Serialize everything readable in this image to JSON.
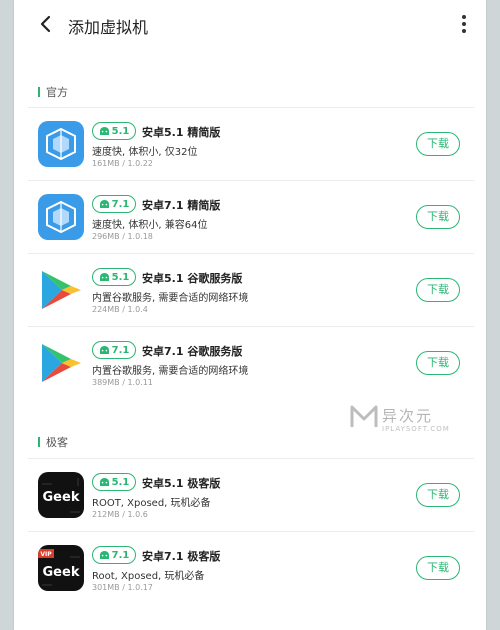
{
  "header": {
    "title": "添加虚拟机"
  },
  "sections": [
    {
      "label": "官方",
      "items": [
        {
          "version": "5.1",
          "name": "安卓5.1 精简版",
          "desc": "速度快, 体积小, 仅32位",
          "meta": "161MB / 1.0.22",
          "button": "下载",
          "icon": "vmos-cube-icon"
        },
        {
          "version": "7.1",
          "name": "安卓7.1 精简版",
          "desc": "速度快, 体积小, 兼容64位",
          "meta": "296MB / 1.0.18",
          "button": "下载",
          "icon": "vmos-cube-icon"
        },
        {
          "version": "5.1",
          "name": "安卓5.1 谷歌服务版",
          "desc": "内置谷歌服务, 需要合适的网络环境",
          "meta": "224MB / 1.0.4",
          "button": "下载",
          "icon": "google-play-icon"
        },
        {
          "version": "7.1",
          "name": "安卓7.1 谷歌服务版",
          "desc": "内置谷歌服务, 需要合适的网络环境",
          "meta": "389MB / 1.0.11",
          "button": "下载",
          "icon": "google-play-icon"
        }
      ]
    },
    {
      "label": "极客",
      "items": [
        {
          "version": "5.1",
          "name": "安卓5.1 极客版",
          "desc": "ROOT, Xposed, 玩机必备",
          "meta": "212MB / 1.0.6",
          "button": "下载",
          "icon": "geek-icon",
          "icon_text": "Geek"
        },
        {
          "version": "7.1",
          "name": "安卓7.1 极客版",
          "desc": "Root, Xposed, 玩机必备",
          "meta": "301MB / 1.0.17",
          "button": "下载",
          "icon": "geek-vip-icon",
          "icon_text": "Geek",
          "icon_badge": "VIP"
        }
      ]
    }
  ],
  "watermark": {
    "main": "异次元",
    "sub": "IPLAYSOFT.COM"
  },
  "colors": {
    "accent": "#2bb673",
    "vmos_blue": "#3a9be8",
    "geek_bg": "#111111"
  }
}
